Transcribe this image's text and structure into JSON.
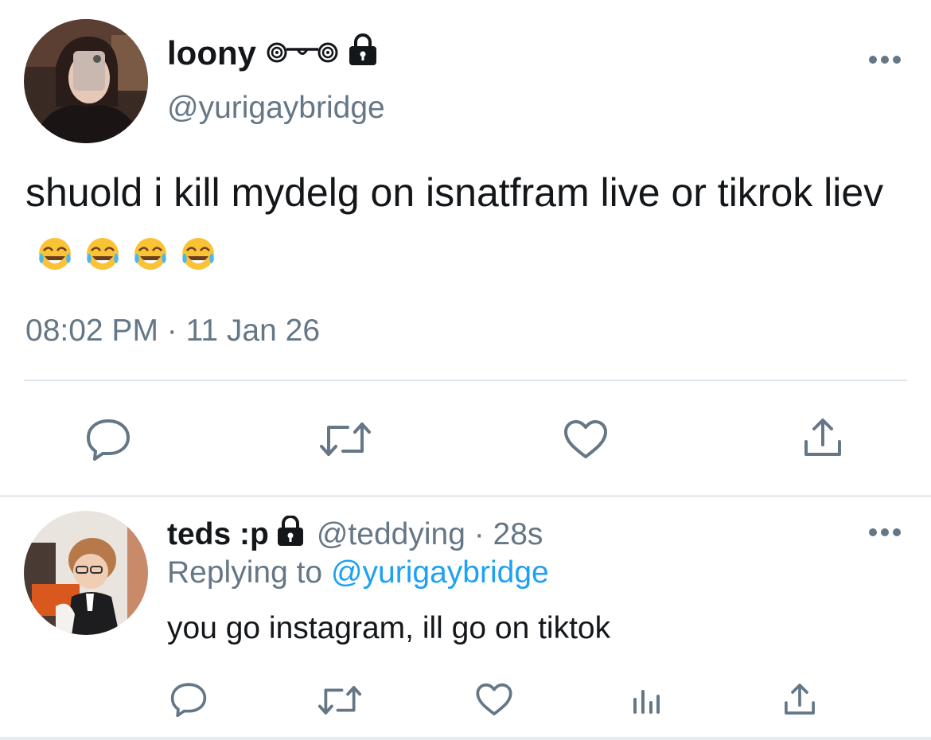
{
  "tweet": {
    "display_name": "loony",
    "name_decoration": "@⌐◎",
    "handle": "@yurigaybridge",
    "text": "shuold i kill mydelg on isnatfram live or tikrok liev",
    "emojis": [
      "face-with-tears-of-joy",
      "face-with-tears-of-joy",
      "face-with-tears-of-joy",
      "face-with-tears-of-joy"
    ],
    "timestamp": "08:02 PM · 11 Jan 26",
    "actions": [
      "reply",
      "retweet",
      "like",
      "share"
    ]
  },
  "reply": {
    "display_name": "teds :p",
    "handle_time": "@teddying · 28s",
    "replying_label": "Replying to",
    "replying_to": "@yurigaybridge",
    "text": "you go instagram, ill go on tiktok",
    "actions": [
      "reply",
      "retweet",
      "like",
      "analytics",
      "share"
    ]
  },
  "colors": {
    "text": "#14171a",
    "secondary": "#657786",
    "link": "#1da1f2",
    "divider": "#e1e8ed"
  }
}
